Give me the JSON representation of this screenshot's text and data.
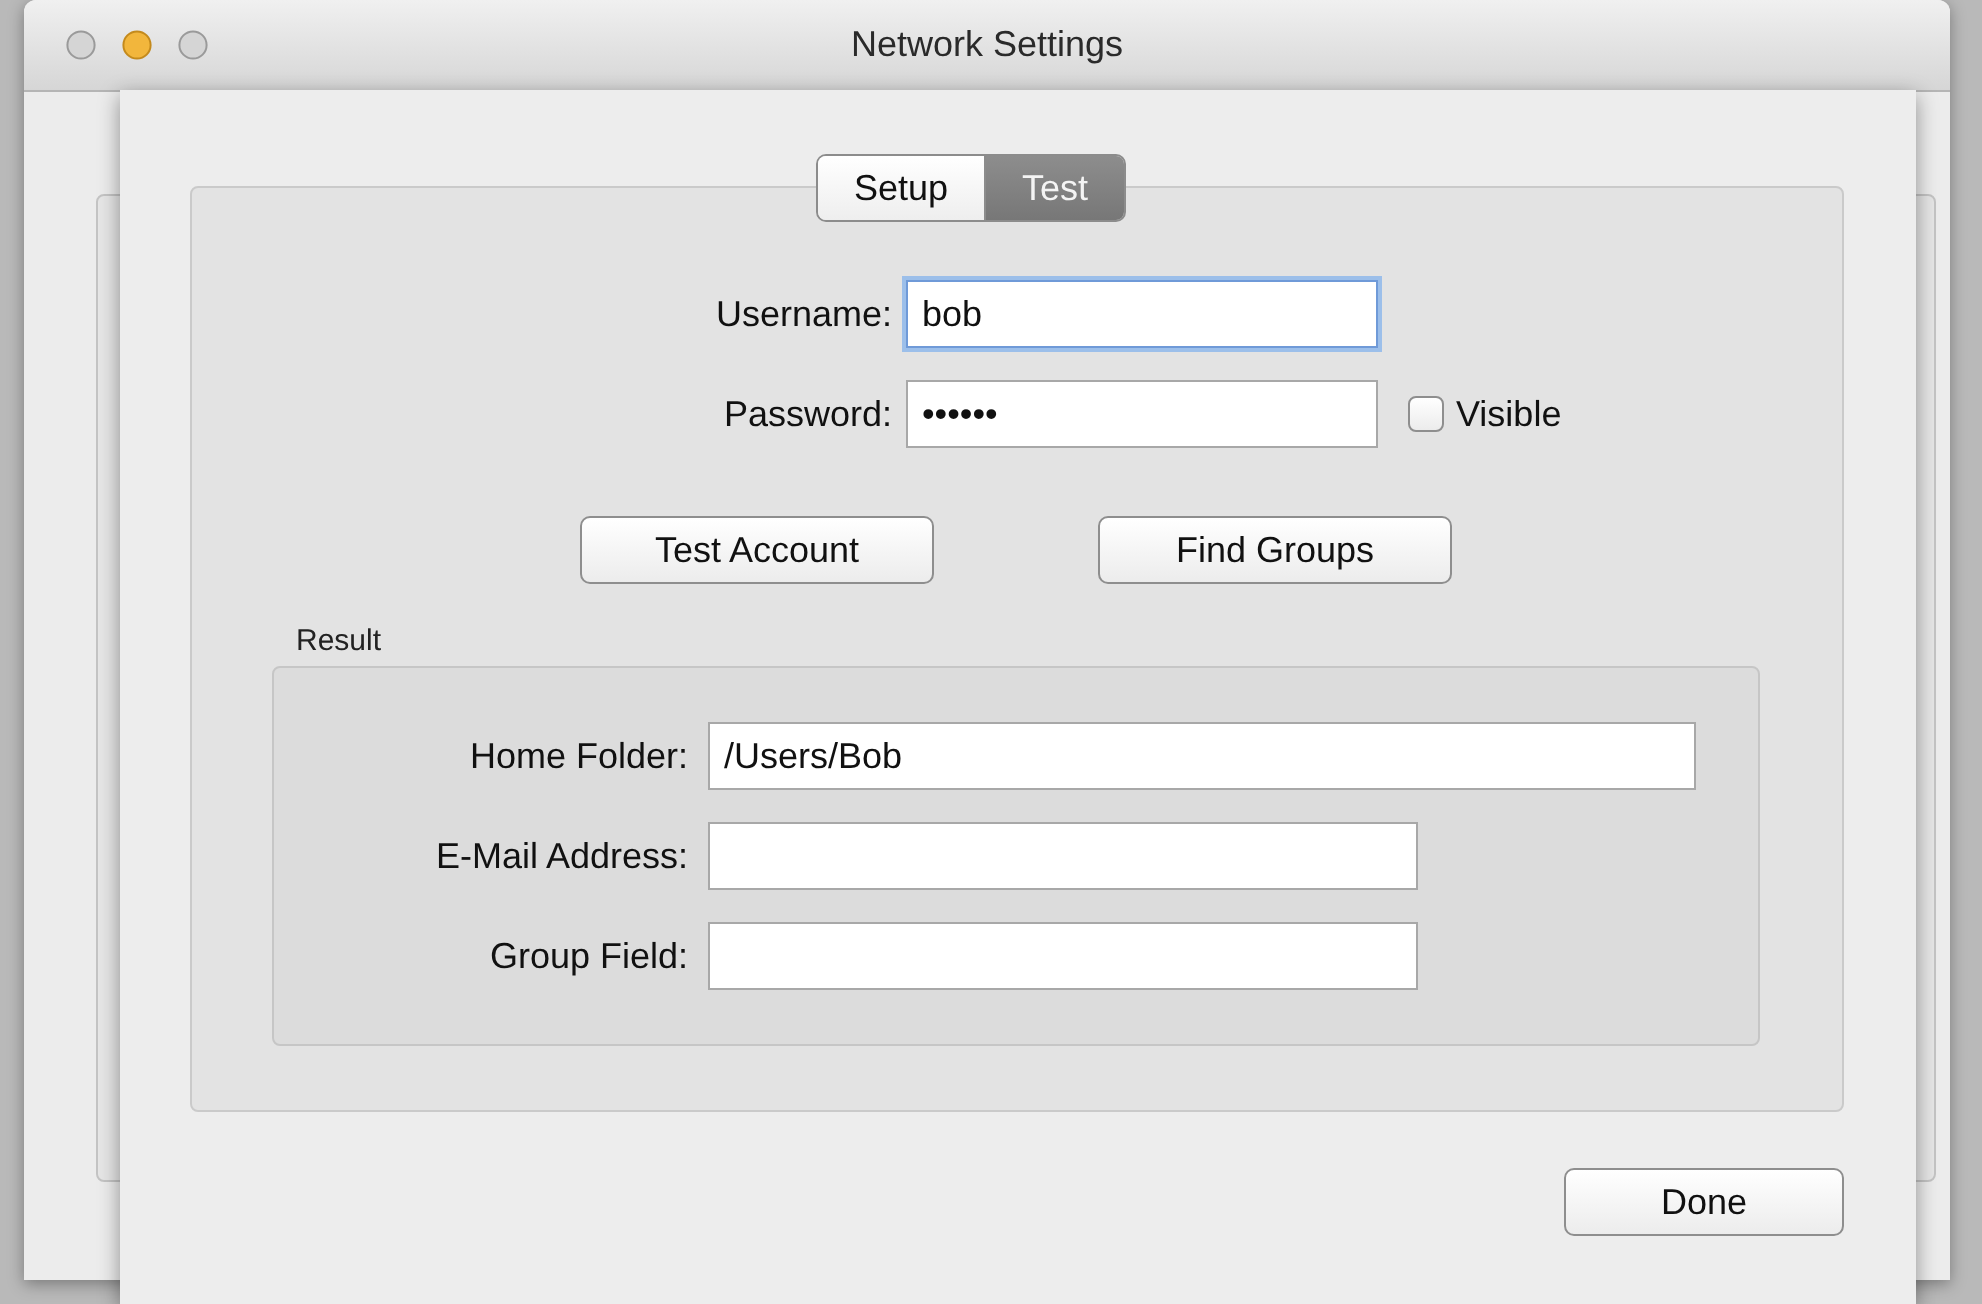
{
  "window": {
    "title": "Network Settings"
  },
  "sheet": {
    "tabs": [
      {
        "label": "Setup",
        "selected": false
      },
      {
        "label": "Test",
        "selected": true
      }
    ],
    "username": {
      "label": "Username:",
      "value": "bob",
      "focused": true
    },
    "password": {
      "label": "Password:",
      "masked_value": "••••••",
      "focused": false
    },
    "visible": {
      "label": "Visible",
      "checked": false
    },
    "actions": [
      "Test Account",
      "Find Groups"
    ],
    "result": {
      "title": "Result",
      "fields": [
        {
          "label": "Home Folder:",
          "value": "/Users/Bob"
        },
        {
          "label": "E-Mail Address:"
        },
        {
          "label": "Group Field:"
        }
      ]
    },
    "done": "Done"
  }
}
